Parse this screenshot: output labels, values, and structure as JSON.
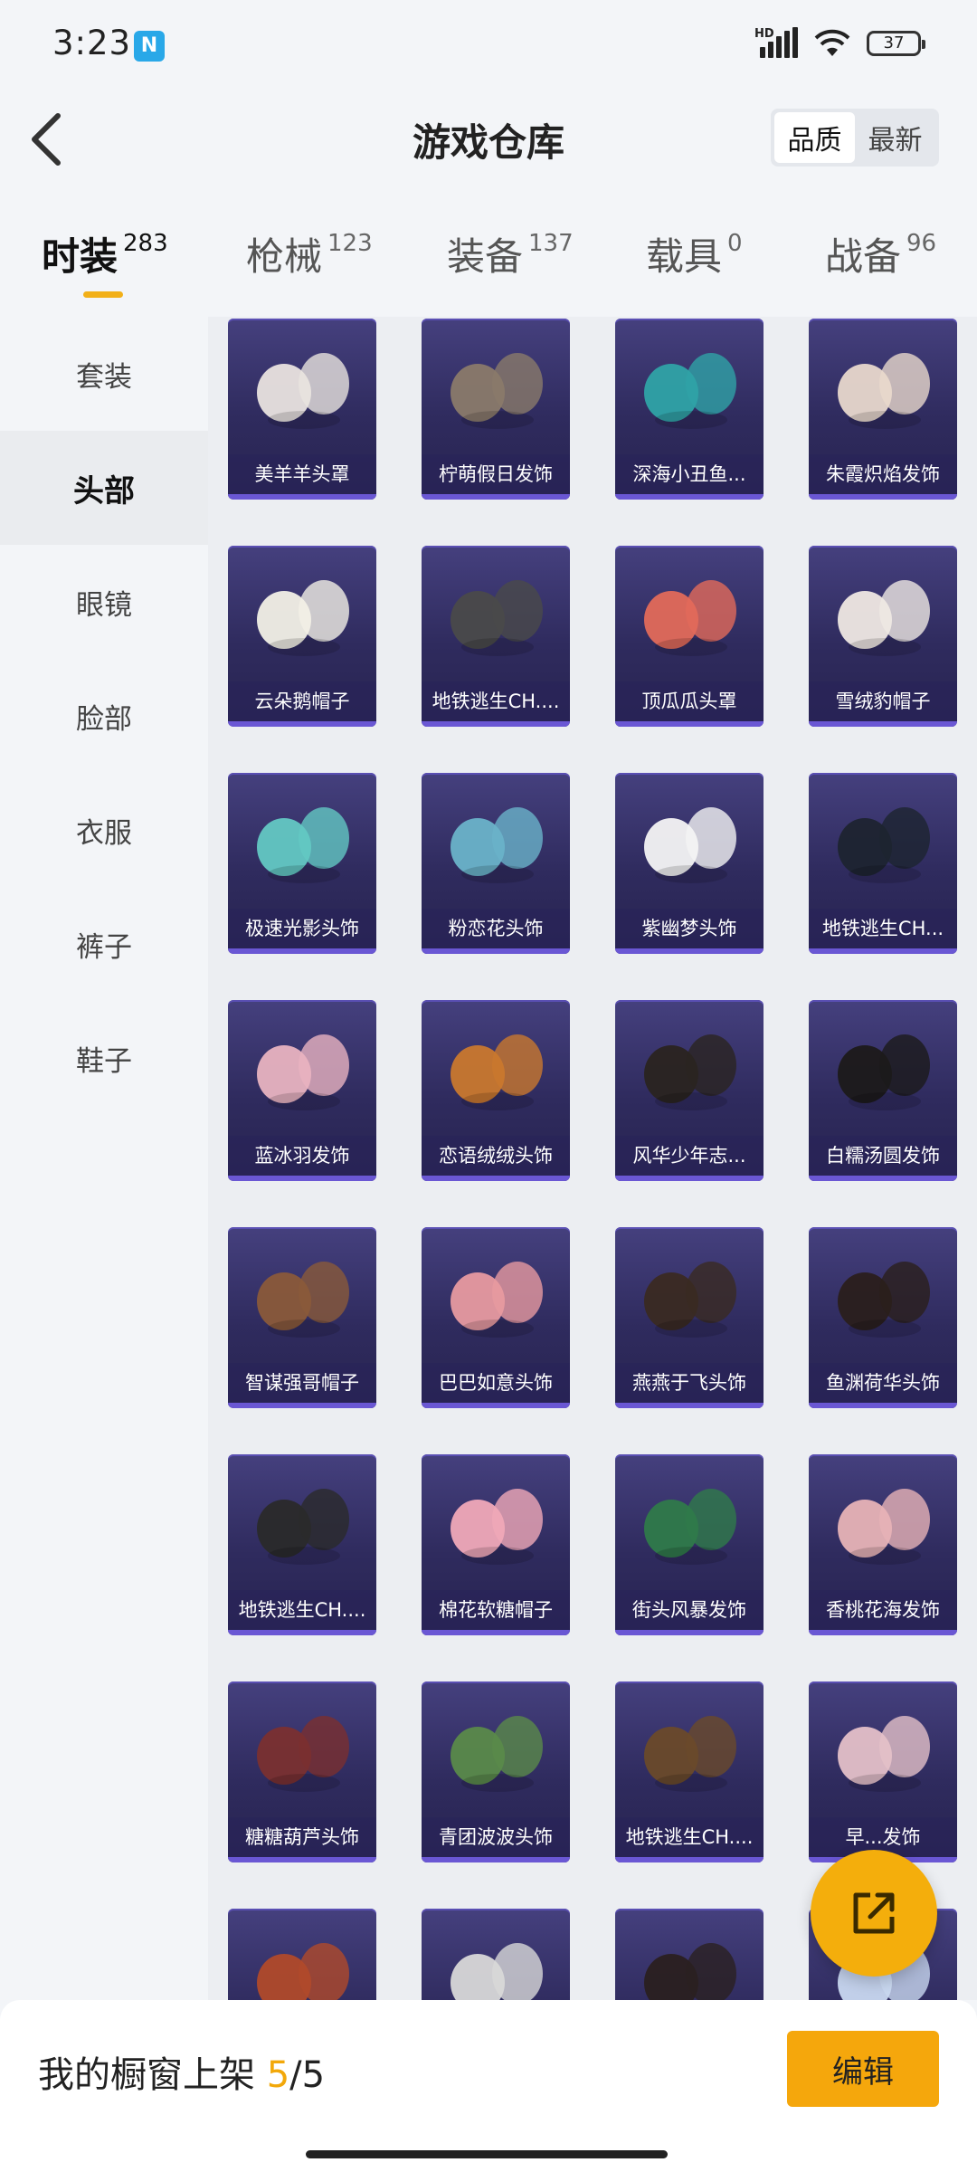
{
  "status_bar": {
    "time": "3:23",
    "network": "HD",
    "battery": "37"
  },
  "header": {
    "title": "游戏仓库",
    "sort_options": [
      "品质",
      "最新"
    ],
    "sort_selected": "品质"
  },
  "tabs": [
    {
      "label": "时装",
      "count": "283",
      "active": true
    },
    {
      "label": "枪械",
      "count": "123"
    },
    {
      "label": "装备",
      "count": "137"
    },
    {
      "label": "载具",
      "count": "0"
    },
    {
      "label": "战备",
      "count": "96"
    }
  ],
  "sidebar": {
    "items": [
      "套装",
      "头部",
      "眼镜",
      "脸部",
      "衣服",
      "裤子",
      "鞋子"
    ],
    "selected": "头部"
  },
  "items": [
    {
      "name": "美羊羊头罩",
      "icon": "sheep-mask-icon"
    },
    {
      "name": "柠萌假日发饰",
      "icon": "hair-icon"
    },
    {
      "name": "深海小丑鱼...",
      "icon": "hair-icon"
    },
    {
      "name": "朱霞炽焰发饰",
      "icon": "hair-icon"
    },
    {
      "name": "云朵鹅帽子",
      "icon": "goose-hat-icon"
    },
    {
      "name": "地铁逃生CH....",
      "icon": "bucket-hat-icon"
    },
    {
      "name": "顶瓜瓜头罩",
      "icon": "watermelon-mask-icon"
    },
    {
      "name": "雪绒豹帽子",
      "icon": "hair-icon"
    },
    {
      "name": "极速光影头饰",
      "icon": "hair-icon"
    },
    {
      "name": "粉恋花头饰",
      "icon": "hair-icon"
    },
    {
      "name": "紫幽梦头饰",
      "icon": "hair-icon"
    },
    {
      "name": "地铁逃生CH...",
      "icon": "cap-icon"
    },
    {
      "name": "蓝冰羽发饰",
      "icon": "hair-icon"
    },
    {
      "name": "恋语绒绒头饰",
      "icon": "hair-icon"
    },
    {
      "name": "风华少年志...",
      "icon": "hair-icon"
    },
    {
      "name": "白糯汤圆发饰",
      "icon": "hair-icon"
    },
    {
      "name": "智谋强哥帽子",
      "icon": "character-head-icon"
    },
    {
      "name": "巴巴如意头饰",
      "icon": "hair-icon"
    },
    {
      "name": "燕燕于飞头饰",
      "icon": "hair-icon"
    },
    {
      "name": "鱼渊荷华头饰",
      "icon": "hair-icon"
    },
    {
      "name": "地铁逃生CH....",
      "icon": "cap-icon"
    },
    {
      "name": "棉花软糖帽子",
      "icon": "hair-icon"
    },
    {
      "name": "街头风暴发饰",
      "icon": "hair-icon"
    },
    {
      "name": "香桃花海发饰",
      "icon": "hair-icon"
    },
    {
      "name": "糖糖葫芦头饰",
      "icon": "hair-icon"
    },
    {
      "name": "青团波波头饰",
      "icon": "hair-icon"
    },
    {
      "name": "地铁逃生CH....",
      "icon": "helmet-icon"
    },
    {
      "name": "早...发饰",
      "icon": "hair-icon"
    },
    {
      "name": "",
      "icon": "goggles-helmet-icon"
    },
    {
      "name": "",
      "icon": "hair-icon"
    },
    {
      "name": "",
      "icon": "hair-icon"
    },
    {
      "name": "",
      "icon": "hair-icon"
    }
  ],
  "bottom": {
    "showcase_label": "我的橱窗上架",
    "showcase_current": "5",
    "showcase_sep": "/",
    "showcase_total": "5",
    "edit_label": "编辑"
  },
  "colors": {
    "accent": "#f5a70c",
    "card_bg": "#3a3570",
    "background": "#f3f5f8"
  }
}
